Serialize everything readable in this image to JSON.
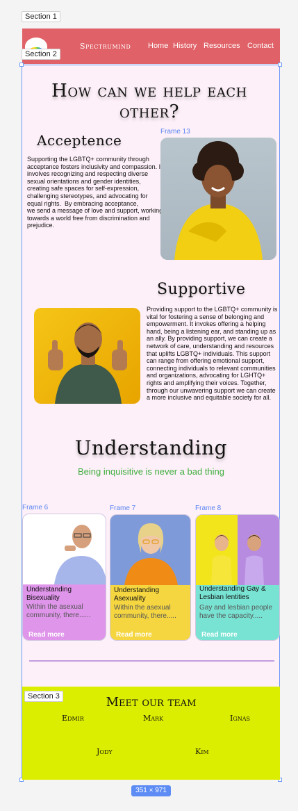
{
  "labels": {
    "section1": "Section 1",
    "section2": "Section 2",
    "section3": "Section 3",
    "frame13": "Frame 13",
    "frame6": "Frame 6",
    "frame7": "Frame 7",
    "frame8": "Frame 8"
  },
  "header": {
    "brand": "Spectrumind",
    "nav": [
      "Home",
      "History",
      "Resources",
      "Contact"
    ]
  },
  "main": {
    "headline": "How can we help each other?",
    "acceptance": {
      "title": "Acceptence",
      "body": "Supporting the LGBTQ+ community through acceptance fosters inclusivity and compassion. It involves recognizing and respecting diverse sexual orientations and gender identities, creating safe spaces for self-expression, challenging stereotypes, and advocating for equal rights.  By embracing acceptance,\nwe send a message of love and support, working towards a world free from discrimination and prejudice."
    },
    "support": {
      "title": "Supportive",
      "body": "Providing support to the LGBTQ+ community is vital for fostering a sense of belonging and empowerment. It invokes offering a helping hand, being a listening ear, and standing up as an ally. By providing support, we can create a network of care, understanding and resources that uplifts LGBTQ+ individuals. This support can range from offering emotional support, connecting individuals to relevant communities and organizations, advocating for LGHTQ+ rights and amplifying their voices. Together, through our unwavering support we can create a more inclusive and equitable society for all."
    },
    "understanding": {
      "title": "Understanding",
      "subtitle": "Being inquisitive is never a bad thing"
    },
    "cards": [
      {
        "title": "Understanding Bisexuality",
        "desc": "Within the asexual community, there......",
        "more": "Read more",
        "color": "#df95ea"
      },
      {
        "title": "Understanding Asexuality",
        "desc": "Within the asexual community, there.....",
        "more": "Read more",
        "color": "#f5d641"
      },
      {
        "title": "Understanding Gay & Lesbian lentities",
        "desc": "Gay and lesbian people have the capacity.....",
        "more": "Read more",
        "color": "#79e3d3"
      }
    ]
  },
  "team": {
    "title": "Meet our team",
    "members": [
      "Edmir",
      "Mark",
      "Ignas",
      "Jody",
      "Kim"
    ]
  },
  "size_badge": "351 × 971"
}
